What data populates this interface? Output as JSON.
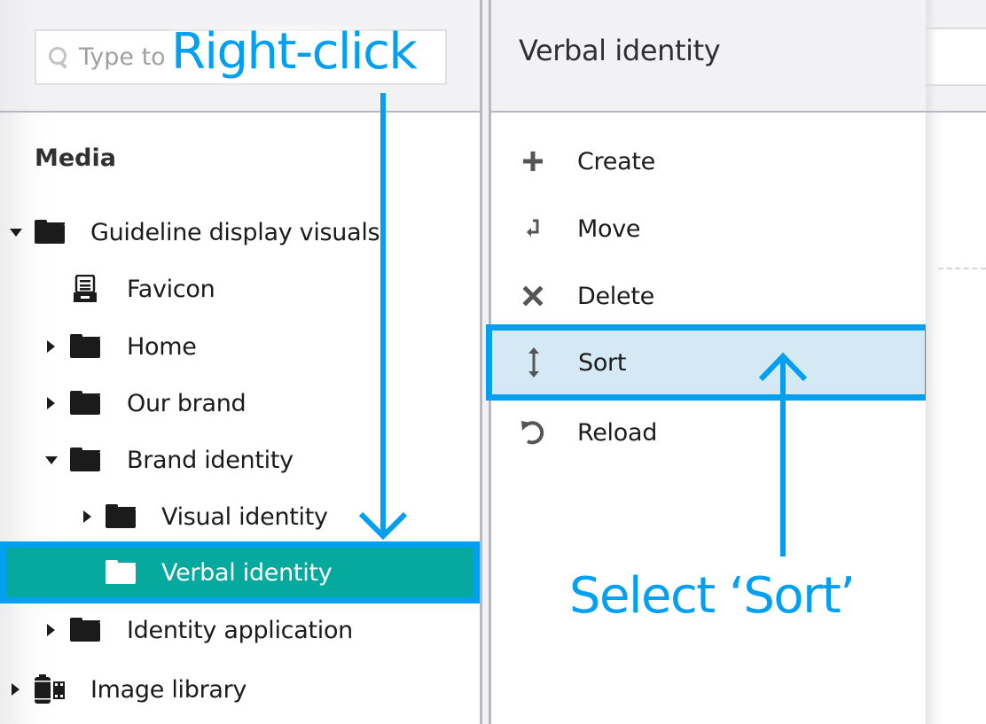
{
  "search": {
    "placeholder": "Type to"
  },
  "tree": {
    "section_title": "Media",
    "items": [
      {
        "label": "Guideline display visuals",
        "icon": "folder-icon",
        "caret": "down",
        "level": 0
      },
      {
        "label": "Favicon",
        "icon": "archive-icon",
        "caret": "none",
        "level": 1
      },
      {
        "label": "Home",
        "icon": "folder-icon",
        "caret": "right",
        "level": 1
      },
      {
        "label": "Our brand",
        "icon": "folder-icon",
        "caret": "right",
        "level": 1
      },
      {
        "label": "Brand identity",
        "icon": "folder-icon",
        "caret": "down",
        "level": 1
      },
      {
        "label": "Visual identity",
        "icon": "folder-icon",
        "caret": "right",
        "level": 2
      },
      {
        "label": "Verbal identity",
        "icon": "folder-icon",
        "caret": "none",
        "level": 2,
        "selected": true
      },
      {
        "label": "Identity application",
        "icon": "folder-icon",
        "caret": "right",
        "level": 1
      },
      {
        "label": "Image library",
        "icon": "media-library-icon",
        "caret": "right",
        "level": 0
      }
    ]
  },
  "menu": {
    "title": "Verbal identity",
    "items": [
      {
        "label": "Create",
        "icon": "plus-icon"
      },
      {
        "label": "Move",
        "icon": "move-arrow-icon"
      },
      {
        "label": "Delete",
        "icon": "x-icon"
      },
      {
        "label": "Sort",
        "icon": "sort-vertical-icon",
        "highlighted": true
      },
      {
        "label": "Reload",
        "icon": "reload-icon"
      }
    ]
  },
  "annotations": {
    "right_click": "Right-click",
    "select_sort": "Select ‘Sort’"
  },
  "colors": {
    "annotation_blue": "#03a0f1",
    "selected_row": "#06a99d",
    "highlight_bg": "#d5e9f5"
  }
}
